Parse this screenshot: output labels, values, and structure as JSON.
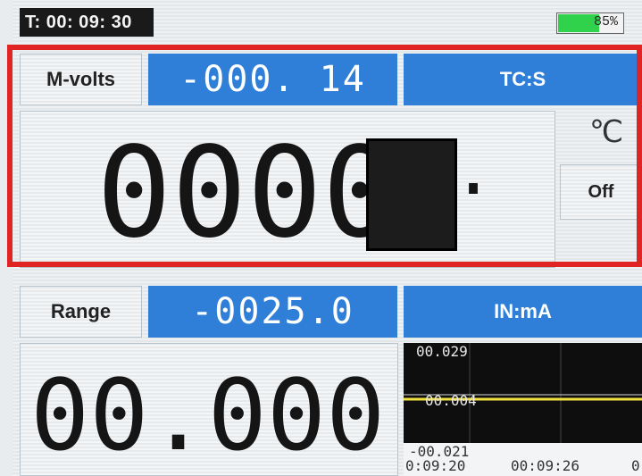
{
  "status": {
    "timer": "T: 00: 09: 30",
    "battery_percent": "85%",
    "battery_level": 0.62,
    "battery_color": "#2fd24a"
  },
  "channel1": {
    "mode_label": "M-volts",
    "measured_value": "-000. 14",
    "sensor_type": "TC:S",
    "main_reading": "0000",
    "decimal_point": ".",
    "unit_symbol": "℃",
    "toggle_label": "Off"
  },
  "channel2": {
    "mode_label": "Range",
    "range_value": "-0025.0",
    "input_type": "IN:mA",
    "main_reading": "00.000"
  },
  "trend": {
    "y_max": "00.029",
    "y_mid": "00.004",
    "y_min": "-00.021",
    "x_start": "0:09:20",
    "x_mid": "00:09:26",
    "x_end": "0"
  },
  "colors": {
    "accent_blue": "#2f7fd8",
    "highlight_frame": "#e02424",
    "trend_line": "#f0e040"
  }
}
